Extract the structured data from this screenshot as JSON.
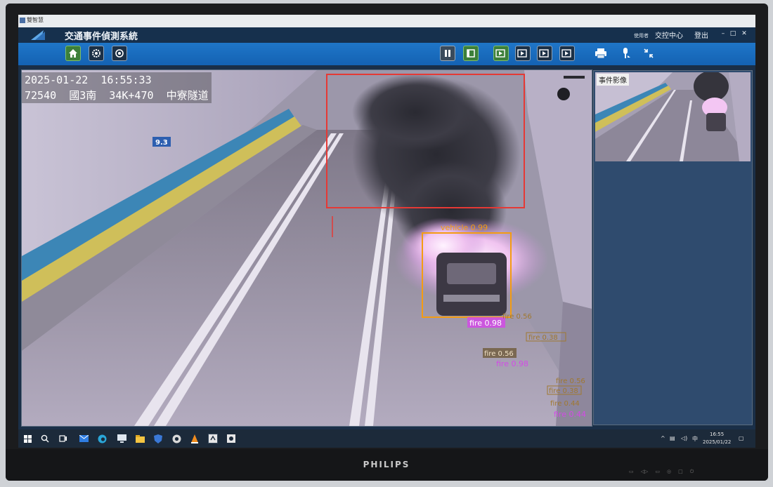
{
  "window": {
    "mini_title": "雙智慧"
  },
  "header": {
    "title": "交通事件偵測系統",
    "user_label": "使用者",
    "user_name": "交控中心",
    "logout_label": "登出",
    "minimize": "–",
    "maximize": "□",
    "close": "✕"
  },
  "toolbar": {
    "left_icons": [
      "home-icon",
      "settings-icon",
      "reset-icon"
    ],
    "right_icons": [
      "pause-icon",
      "stop-icon",
      "video-1-icon",
      "video-2-icon",
      "video-3-icon",
      "video-4-icon",
      "print-icon",
      "pin-icon",
      "collapse-icon"
    ]
  },
  "main_video": {
    "timestamp": "2025-01-22  16:55:33",
    "location": "72540  國3南  34K+470  中寮隧道",
    "tunnel_sign": "9.3",
    "detections": [
      {
        "label": "vehicle 0.99",
        "color": "#f39c12"
      },
      {
        "label": "fire 0.98",
        "color": "#d24be6"
      },
      {
        "label": "fire 0.56",
        "color": "#a07830"
      },
      {
        "label": "fire 0.38",
        "color": "#a07830"
      },
      {
        "label": "fire 0.56",
        "color": "#a07830"
      },
      {
        "label": "fire 0.98",
        "color": "#d24be6"
      },
      {
        "label": "fire 0.56",
        "color": "#a07830"
      },
      {
        "label": "fire 0.38",
        "color": "#a07830"
      },
      {
        "label": "fire 0.44",
        "color": "#a07830"
      },
      {
        "label": "fire 0.44",
        "color": "#d24be6"
      }
    ],
    "alert_color": "#e53935"
  },
  "side_panel": {
    "label": "事件影像"
  },
  "taskbar": {
    "apps": [
      "windows-icon",
      "search-icon",
      "task-view-icon",
      "mail-icon",
      "edge-icon",
      "remote-desktop-icon",
      "file-explorer-icon",
      "shield-app-icon",
      "chrome-icon",
      "vlc-icon",
      "app-a-icon",
      "app-b-icon"
    ],
    "ime": "中",
    "time": "16:55",
    "date": "2025/01/22"
  },
  "monitor": {
    "brand": "PHILIPS"
  },
  "colors": {
    "toolbar": "#1a6cbf",
    "header": "#16304d",
    "panel": "#2f4b6e"
  }
}
